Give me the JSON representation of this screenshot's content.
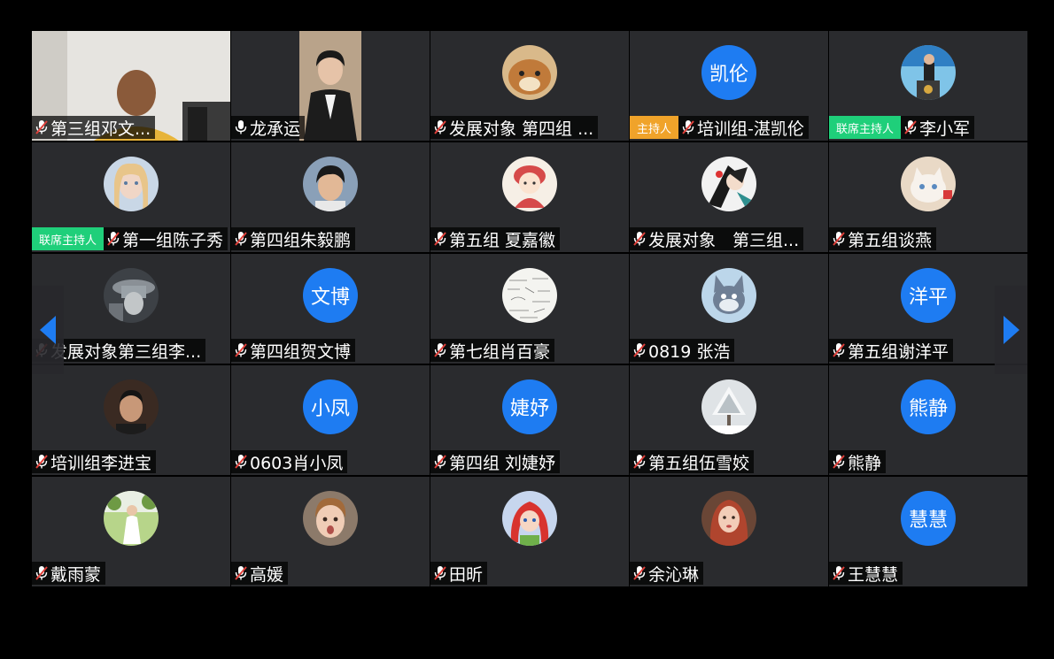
{
  "colors": {
    "avatar_blue": "#1e7cf2",
    "host_badge": "#f0a32a",
    "cohost_badge": "#1fcf7a",
    "tile_bg": "#2a2b2e"
  },
  "nav": {
    "prev_icon": "chevron-left-icon",
    "next_icon": "chevron-right-icon"
  },
  "participants": [
    {
      "name": "第三组邓文...",
      "mic": "muted",
      "kind": "video"
    },
    {
      "name": "龙承运",
      "mic": "active",
      "kind": "video"
    },
    {
      "name": "发展对象 第四组 ...",
      "mic": "muted",
      "kind": "photo",
      "avatar": "dog-photo"
    },
    {
      "name": "培训组-湛凯伦",
      "mic": "muted",
      "kind": "text",
      "avatar_text": "凯伦",
      "badge": "主持人",
      "badge_type": "host"
    },
    {
      "name": "李小军",
      "mic": "muted",
      "kind": "photo",
      "avatar": "stage-photo",
      "badge": "联席主持人",
      "badge_type": "cohost"
    },
    {
      "name": "第一组陈子秀",
      "mic": "muted",
      "kind": "photo",
      "avatar": "woman-photo",
      "badge": "联席主持人",
      "badge_type": "cohost"
    },
    {
      "name": "第四组朱毅鹏",
      "mic": "muted",
      "kind": "photo",
      "avatar": "man-photo"
    },
    {
      "name": "第五组 夏嘉徽",
      "mic": "muted",
      "kind": "photo",
      "avatar": "cartoon-girl"
    },
    {
      "name": "发展对象　第三组...",
      "mic": "muted",
      "kind": "photo",
      "avatar": "anime-photo"
    },
    {
      "name": "第五组谈燕",
      "mic": "muted",
      "kind": "photo",
      "avatar": "kitten-photo"
    },
    {
      "name": "发展对象第三组李...",
      "mic": "muted",
      "kind": "photo",
      "avatar": "person-hat"
    },
    {
      "name": "第四组贺文博",
      "mic": "muted",
      "kind": "text",
      "avatar_text": "文博"
    },
    {
      "name": "第七组肖百豪",
      "mic": "muted",
      "kind": "photo",
      "avatar": "sketch-photo"
    },
    {
      "name": "0819 张浩",
      "mic": "muted",
      "kind": "photo",
      "avatar": "cartoon-cat"
    },
    {
      "name": "第五组谢洋平",
      "mic": "muted",
      "kind": "text",
      "avatar_text": "洋平"
    },
    {
      "name": "培训组李进宝",
      "mic": "muted",
      "kind": "photo",
      "avatar": "man-dark"
    },
    {
      "name": "0603肖小凤",
      "mic": "muted",
      "kind": "text",
      "avatar_text": "小凤"
    },
    {
      "name": "第四组 刘婕妤",
      "mic": "muted",
      "kind": "text",
      "avatar_text": "婕妤"
    },
    {
      "name": "第五组伍雪姣",
      "mic": "muted",
      "kind": "photo",
      "avatar": "snow-tree"
    },
    {
      "name": "熊静",
      "mic": "muted",
      "kind": "text",
      "avatar_text": "熊静"
    },
    {
      "name": "戴雨蒙",
      "mic": "muted",
      "kind": "photo",
      "avatar": "girl-field"
    },
    {
      "name": "高媛",
      "mic": "muted",
      "kind": "photo",
      "avatar": "child-photo"
    },
    {
      "name": "田昕",
      "mic": "muted",
      "kind": "photo",
      "avatar": "mermaid-cartoon"
    },
    {
      "name": "余沁琳",
      "mic": "muted",
      "kind": "photo",
      "avatar": "woman-redhair"
    },
    {
      "name": "王慧慧",
      "mic": "muted",
      "kind": "text",
      "avatar_text": "慧慧"
    }
  ]
}
